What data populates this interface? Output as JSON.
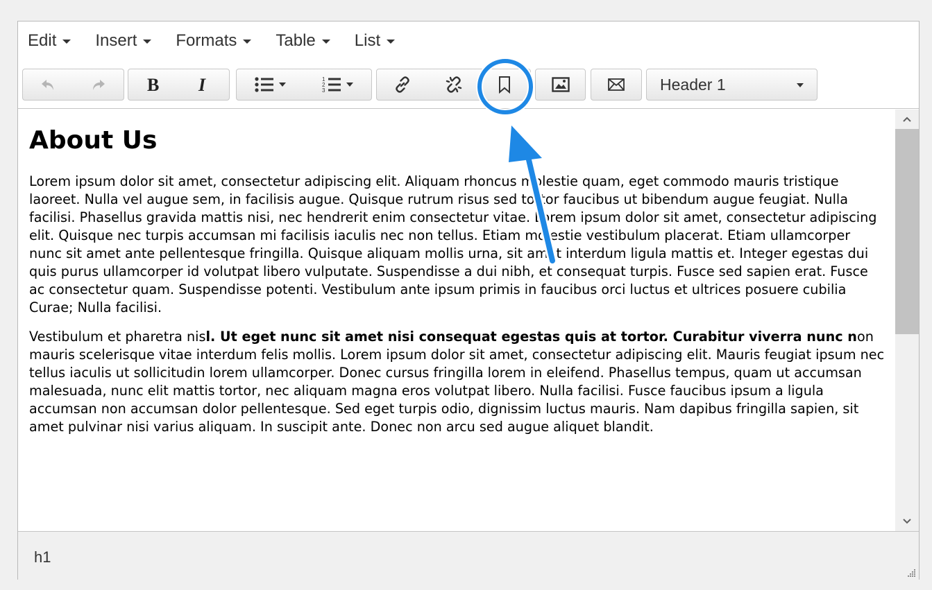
{
  "menubar": {
    "items": [
      {
        "label": "Edit"
      },
      {
        "label": "Insert"
      },
      {
        "label": "Formats"
      },
      {
        "label": "Table"
      },
      {
        "label": "List"
      }
    ]
  },
  "toolbar": {
    "icons": [
      "undo-icon",
      "redo-icon",
      "bold-icon",
      "italic-icon",
      "bullet-list-icon",
      "numbered-list-icon",
      "link-icon",
      "unlink-icon",
      "bookmark-icon",
      "image-icon",
      "email-icon"
    ],
    "block_format": "Header 1"
  },
  "content": {
    "heading": "About Us",
    "paragraph1": "Lorem ipsum dolor sit amet, consectetur adipiscing elit. Aliquam rhoncus molestie quam, eget commodo mauris tristique laoreet. Nulla vel augue sem, in facilisis augue. Quisque rutrum risus sed tortor faucibus ut bibendum augue feugiat. Nulla facilisi. Phasellus gravida mattis nisi, nec hendrerit enim consectetur vitae. Lorem ipsum dolor sit amet, consectetur adipiscing elit. Quisque nec turpis accumsan mi facilisis iaculis nec non tellus. Etiam molestie vestibulum placerat. Etiam ullamcorper nunc sit amet ante pellentesque fringilla. Quisque aliquam mollis urna, sit amet interdum ligula mattis et. Integer egestas dui quis purus ullamcorper id volutpat libero vulputate. Suspendisse a dui nibh, et consequat turpis. Fusce sed sapien erat. Fusce ac consectetur quam. Suspendisse potenti. Vestibulum ante ipsum primis in faucibus orci luctus et ultrices posuere cubilia Curae; Nulla facilisi.",
    "paragraph2_start": "Vestibulum et pharetra nis",
    "paragraph2_bold": "l. Ut eget nunc sit amet nisi consequat egestas quis at tortor. Curabitur viverra nunc n",
    "paragraph2_rest": "on mauris scelerisque vitae interdum felis mollis. Lorem ipsum dolor sit amet, consectetur adipiscing elit. Mauris feugiat ipsum nec tellus iaculis ut sollicitudin lorem ullamcorper. Donec cursus fringilla lorem in eleifend. Phasellus tempus, quam ut accumsan malesuada, nunc elit mattis tortor, nec aliquam magna eros volutpat libero. Nulla facilisi. Fusce faucibus ipsum a ligula accumsan non accumsan dolor pellentesque. Sed eget turpis odio, dignissim luctus mauris. Nam dapibus fringilla sapien, sit amet pulvinar nisi varius aliquam. In suscipit ante. Donec non arcu sed augue aliquet blandit."
  },
  "statusbar": {
    "path": "h1"
  },
  "colors": {
    "annotation": "#1e88e5",
    "toolbar_border": "#c7c7c7",
    "statusbar_bg": "#f0f0f0"
  }
}
